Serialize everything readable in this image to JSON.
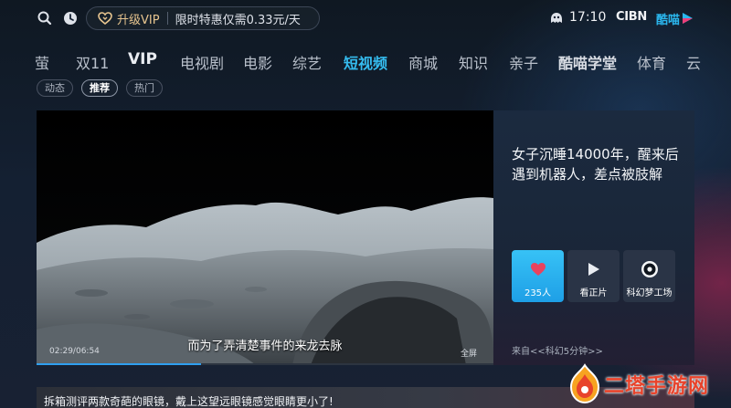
{
  "topbar": {
    "vip_label": "升级VIP",
    "vip_promo": "限时特惠仅需0.33元/天",
    "time": "17:10",
    "cibn": "CIBN",
    "brand": "酷喵"
  },
  "nav": {
    "items": [
      "萤",
      "双11",
      "VIP",
      "电视剧",
      "电影",
      "综艺",
      "短视频",
      "商城",
      "知识",
      "亲子",
      "酷喵学堂",
      "体育",
      "云"
    ],
    "active": "短视频"
  },
  "subtabs": [
    "动态",
    "推荐",
    "热门"
  ],
  "player": {
    "subtitle": "而为了弄清楚事件的来龙去脉",
    "time": "02:29/06:54",
    "fullscreen": "全屏",
    "progress_percent": 36
  },
  "info": {
    "title": "女子沉睡14000年，醒来后遇到机器人，差点被肢解",
    "like_count": "235人",
    "watch_label": "看正片",
    "channel_label": "科幻梦工场",
    "source": "来自<<科幻5分钟>>"
  },
  "next": {
    "title": "拆箱测评两款奇葩的眼镜，戴上这望远眼镜感觉眼睛更小了!"
  },
  "watermark": {
    "text": "二塔手游网"
  },
  "colors": {
    "accent": "#35bdf0",
    "vip_gold": "#e7c58f",
    "like_blue": "#1e9fe6",
    "watermark_red": "#e8432b"
  }
}
